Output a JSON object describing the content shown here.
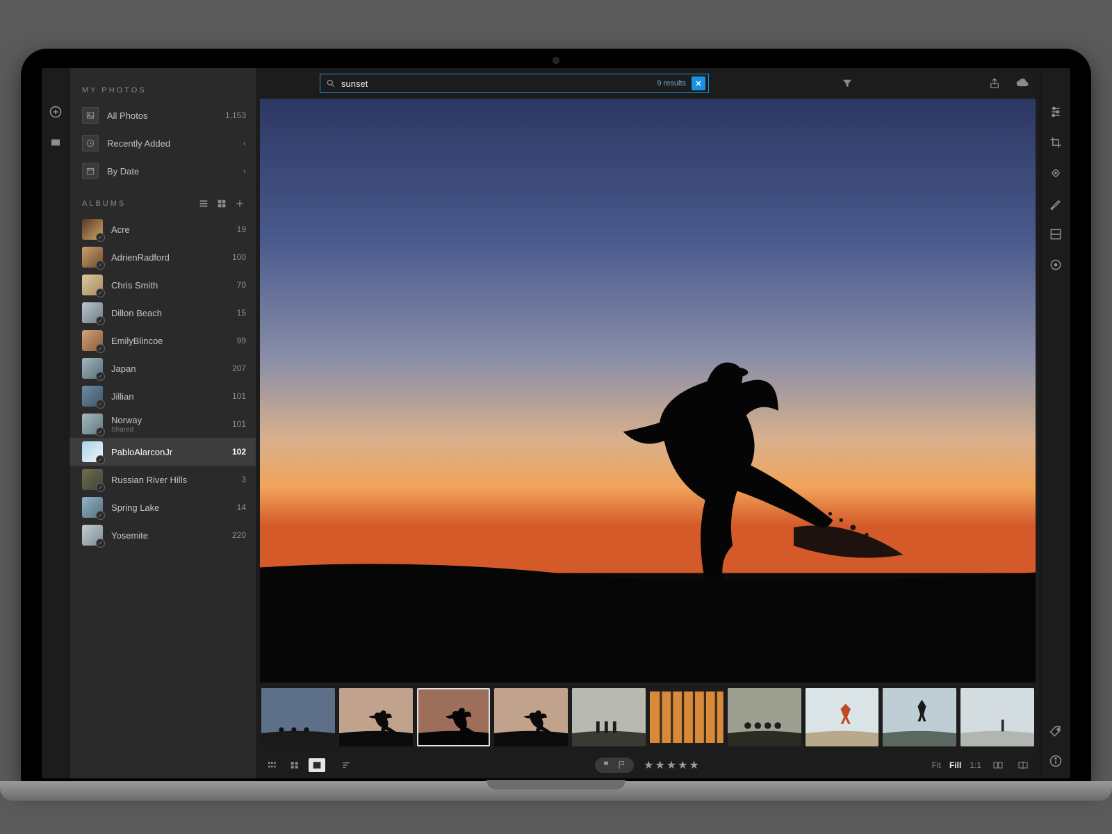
{
  "search": {
    "value": "sunset",
    "results_label": "9 results"
  },
  "sidebar": {
    "section_my_photos": "MY PHOTOS",
    "nav": [
      {
        "icon": "image",
        "label": "All Photos",
        "meta": "1,153"
      },
      {
        "icon": "clock",
        "label": "Recently Added",
        "meta": "‹"
      },
      {
        "icon": "calendar",
        "label": "By Date",
        "meta": "‹"
      }
    ],
    "section_albums": "ALBUMS",
    "albums": [
      {
        "name": "Acre",
        "count": "19",
        "colors": [
          "#5b3a25",
          "#cda36b"
        ]
      },
      {
        "name": "AdrienRadford",
        "count": "100",
        "colors": [
          "#caa06a",
          "#6b4a2f"
        ]
      },
      {
        "name": "Chris Smith",
        "count": "70",
        "colors": [
          "#d8c9a0",
          "#a88b5e"
        ]
      },
      {
        "name": "Dillon Beach",
        "count": "15",
        "colors": [
          "#b8c7cf",
          "#6d7a80"
        ]
      },
      {
        "name": "EmilyBlincoe",
        "count": "99",
        "colors": [
          "#cfa27a",
          "#8a5c3a"
        ]
      },
      {
        "name": "Japan",
        "count": "207",
        "colors": [
          "#9fb5bf",
          "#5a6f78"
        ]
      },
      {
        "name": "Jillian",
        "count": "101",
        "colors": [
          "#6c8aa0",
          "#3e5668"
        ]
      },
      {
        "name": "Norway",
        "sub": "Shared",
        "count": "101",
        "colors": [
          "#a7b8bd",
          "#5f7880"
        ]
      },
      {
        "name": "PabloAlarconJr",
        "count": "102",
        "selected": true,
        "colors": [
          "#a9d3ef",
          "#f0f3f5"
        ]
      },
      {
        "name": "Russian River Hills",
        "count": "3",
        "colors": [
          "#6f6d52",
          "#3f4334"
        ]
      },
      {
        "name": "Spring Lake",
        "count": "14",
        "colors": [
          "#8fb4c6",
          "#55707e"
        ]
      },
      {
        "name": "Yosemite",
        "count": "220",
        "colors": [
          "#c3cdd2",
          "#7b8c94"
        ]
      }
    ]
  },
  "filmstrip": [
    {
      "kind": "beach-night"
    },
    {
      "kind": "sunset-kick-light",
      "selectable_hint": "similar"
    },
    {
      "kind": "sunset-kick",
      "selected": true
    },
    {
      "kind": "sunset-kick-light"
    },
    {
      "kind": "landscape-people"
    },
    {
      "kind": "forest"
    },
    {
      "kind": "group"
    },
    {
      "kind": "jump-beach"
    },
    {
      "kind": "jump-mountain"
    },
    {
      "kind": "beach-walk"
    }
  ],
  "bottombar": {
    "rating": "★★★★★",
    "zoom": {
      "fit": "Fit",
      "fill": "Fill",
      "oneone": "1:1",
      "active": "fill"
    }
  }
}
